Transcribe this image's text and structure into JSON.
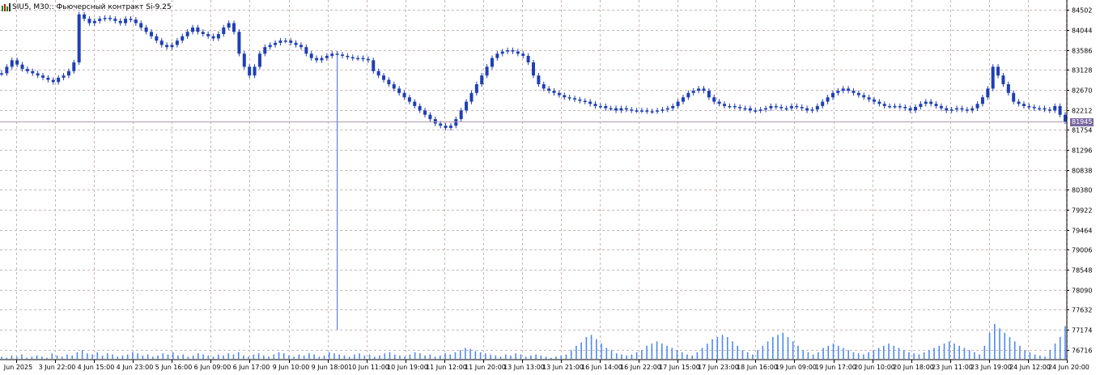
{
  "window": {
    "title": "SIU5, M30:: Фьючерсный контракт Si-9.25",
    "icon": "chart-bars-icon"
  },
  "colors": {
    "background": "#ffffff",
    "grid": "#c8b6b6",
    "candle": "#1f3fb5",
    "volume": "#4f8af0",
    "spike": "#5a7ef0",
    "price_line": "#b09aa8",
    "price_tag_bg": "#7a6aa0"
  },
  "current_price": "81945",
  "chart_data": {
    "type": "line",
    "title": "",
    "symbol": "SIU5",
    "timeframe": "M30",
    "y_ticks": [
      "84502",
      "84044",
      "83586",
      "83128",
      "82670",
      "82212",
      "81754",
      "81296",
      "80838",
      "80380",
      "79922",
      "79464",
      "79006",
      "78548",
      "78090",
      "77632",
      "77174",
      "76716"
    ],
    "ylim": [
      76490,
      84730
    ],
    "grid": true,
    "x_tick_labels": [
      "Jun 2025",
      "3 Jun 22:00",
      "4 Jun 15:00",
      "4 Jun 23:00",
      "5 Jun 16:00",
      "6 Jun 09:00",
      "6 Jun 17:00",
      "9 Jun 10:00",
      "9 Jun 18:00",
      "10 Jun 11:00",
      "10 Jun 19:00",
      "11 Jun 12:00",
      "11 Jun 20:00",
      "13 Jun 13:00",
      "13 Jun 21:00",
      "16 Jun 14:00",
      "16 Jun 22:00",
      "17 Jun 15:00",
      "17 Jun 23:00",
      "18 Jun 16:00",
      "19 Jun 09:00",
      "19 Jun 17:00",
      "20 Jun 10:00",
      "20 Jun 18:00",
      "23 Jun 11:00",
      "23 Jun 19:00",
      "24 Jun 12:00",
      "24 Jun 20:00"
    ],
    "series": [
      {
        "values": [
          83050,
          83200,
          83350,
          83250,
          83150,
          83100,
          83050,
          83000,
          82950,
          82900,
          82850,
          82950,
          83000,
          83100,
          83300,
          84400,
          84300,
          84200,
          84250,
          84300,
          84320,
          84300,
          84250,
          84200,
          84300,
          84280,
          84200,
          84100,
          84000,
          83900,
          83800,
          83700,
          83650,
          83700,
          83800,
          83900,
          84000,
          84100,
          84000,
          83950,
          83900,
          83850,
          83950,
          84100,
          84200,
          84000,
          83500,
          83200,
          83000,
          83200,
          83500,
          83650,
          83700,
          83750,
          83800,
          83800,
          83750,
          83700,
          83650,
          83500,
          83400,
          83350,
          83400,
          83450,
          83500,
          83480,
          83450,
          83420,
          83400,
          83400,
          83380,
          83350,
          83100,
          83000,
          82900,
          82800,
          82700,
          82600,
          82500,
          82400,
          82300,
          82200,
          82100,
          82000,
          81900,
          81850,
          81800,
          81850,
          82000,
          82200,
          82400,
          82600,
          82800,
          83000,
          83200,
          83400,
          83500,
          83550,
          83580,
          83550,
          83500,
          83450,
          83300,
          83000,
          82800,
          82700,
          82650,
          82600,
          82550,
          82500,
          82480,
          82450,
          82420,
          82400,
          82350,
          82300,
          82300,
          82250,
          82250,
          82200,
          82250,
          82220,
          82200,
          82200,
          82200,
          82180,
          82180,
          82200,
          82220,
          82250,
          82300,
          82400,
          82500,
          82600,
          82650,
          82700,
          82650,
          82500,
          82400,
          82350,
          82300,
          82300,
          82280,
          82250,
          82250,
          82200,
          82200,
          82220,
          82250,
          82300,
          82280,
          82250,
          82250,
          82300,
          82280,
          82250,
          82200,
          82220,
          82300,
          82400,
          82500,
          82600,
          82650,
          82700,
          82650,
          82600,
          82550,
          82500,
          82450,
          82400,
          82350,
          82300,
          82300,
          82300,
          82280,
          82250,
          82200,
          82280,
          82350,
          82400,
          82350,
          82300,
          82250,
          82200,
          82220,
          82250,
          82220,
          82200,
          82250,
          82350,
          82500,
          82700,
          83200,
          83000,
          82800,
          82600,
          82400,
          82350,
          82300,
          82280,
          82250,
          82250,
          82220,
          82200,
          82300,
          82100,
          81945
        ]
      }
    ],
    "outlier_low": 77174,
    "outlier_index": 65,
    "volume": {
      "values": [
        2,
        1,
        3,
        2,
        4,
        1,
        2,
        3,
        2,
        1,
        5,
        3,
        2,
        4,
        3,
        6,
        8,
        5,
        4,
        6,
        3,
        5,
        4,
        2,
        3,
        4,
        6,
        5,
        3,
        4,
        2,
        3,
        5,
        4,
        6,
        3,
        4,
        2,
        3,
        5,
        4,
        3,
        2,
        4,
        3,
        5,
        4,
        6,
        3,
        2,
        4,
        5,
        3,
        2,
        4,
        6,
        5,
        3,
        2,
        4,
        3,
        5,
        4,
        2,
        3,
        6,
        5,
        4,
        3,
        2,
        4,
        5,
        3,
        4,
        2,
        3,
        5,
        6,
        4,
        3,
        2,
        4,
        6,
        5,
        3,
        4,
        2,
        3,
        5,
        4,
        6,
        8,
        10,
        9,
        7,
        6,
        5,
        4,
        3,
        2,
        4,
        3,
        5,
        4,
        2,
        3,
        4,
        3,
        2,
        1,
        2,
        3,
        4,
        8,
        12,
        15,
        20,
        22,
        18,
        14,
        10,
        8,
        5,
        4,
        3,
        4,
        6,
        8,
        12,
        14,
        16,
        14,
        12,
        10,
        8,
        6,
        4,
        3,
        6,
        10,
        14,
        18,
        20,
        22,
        20,
        16,
        12,
        8,
        6,
        4,
        8,
        12,
        16,
        20,
        22,
        24,
        20,
        16,
        12,
        8,
        6,
        4,
        6,
        10,
        12,
        14,
        12,
        10,
        8,
        6,
        5,
        4,
        6,
        8,
        10,
        12,
        14,
        12,
        10,
        8,
        6,
        5,
        4,
        6,
        8,
        10,
        12,
        14,
        16,
        14,
        12,
        10,
        8,
        6,
        4,
        12,
        24,
        32,
        28,
        24,
        20,
        16,
        12,
        8,
        6,
        4,
        3,
        2,
        8,
        14,
        20,
        30
      ]
    }
  }
}
